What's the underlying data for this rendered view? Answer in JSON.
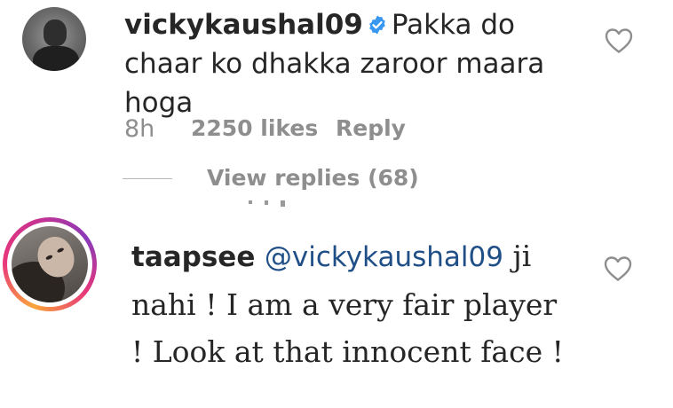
{
  "comments": [
    {
      "username": "vickykaushal09",
      "verified": true,
      "text": "Pakka do chaar ko dhakka zaroor maara hoga",
      "time": "8h",
      "likes": "2250 likes",
      "reply_label": "Reply",
      "view_replies": "View replies (68)"
    },
    {
      "username": "taapsee",
      "mention": "@vickykaushal09",
      "text": " ji nahi ! I am a very fair player ! Look at that innocent face !"
    }
  ],
  "colors": {
    "text": "#262626",
    "meta": "#8e8e8e",
    "verified": "#3897f0",
    "mention": "#1f4f86",
    "story_ring": [
      "#f9a53a",
      "#e8377a",
      "#8a3ab9"
    ]
  },
  "icons": {
    "like": "heart-outline-icon",
    "verified": "verified-badge-icon"
  }
}
